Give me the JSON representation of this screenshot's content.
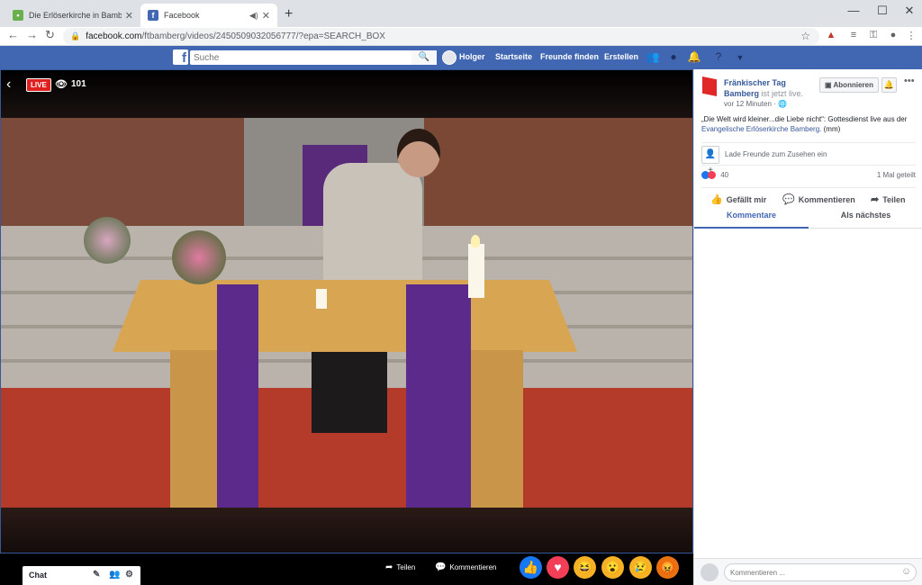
{
  "browser": {
    "tabs": [
      {
        "title": "Die Erlöserkirche in Bamberg ist",
        "active": false
      },
      {
        "title": "Facebook",
        "active": true
      }
    ],
    "new_tab": "+",
    "window_controls": {
      "minimize": "—",
      "maximize": "☐",
      "close": "✕"
    },
    "url_host": "facebook.com",
    "url_path": "/ftbamberg/videos/2450509032056777/?epa=SEARCH_BOX"
  },
  "fb_header": {
    "logo": "f",
    "search_placeholder": "Suche",
    "user_name": "Holger",
    "nav": [
      "Startseite",
      "Freunde finden",
      "Erstellen"
    ]
  },
  "video": {
    "live_label": "LIVE",
    "viewer_count": "101"
  },
  "video_footer": {
    "chat_label": "Chat",
    "share_label": "Teilen",
    "comment_label": "Kommentieren",
    "reactions": [
      "like",
      "love",
      "haha",
      "wow",
      "sad",
      "angry"
    ]
  },
  "panel": {
    "page_name": "Fränkischer Tag Bamberg",
    "live_status": "ist jetzt live.",
    "posted_time": "vor 12 Minuten ·",
    "subscribe_label": "Abonnieren",
    "description_text": "„Die Welt wird kleiner...die Liebe nicht“: Gottesdienst live aus der",
    "description_link": "Evangelische Erlöserkirche Bamberg.",
    "description_suffix": "(mm)",
    "invite_text": "Lade Freunde zum Zusehen ein",
    "reaction_count": "40",
    "share_count": "1 Mal geteilt",
    "actions": {
      "like": "Gefällt mir",
      "comment": "Kommentieren",
      "share": "Teilen"
    },
    "tabs": {
      "comments": "Kommentare",
      "next": "Als nächstes"
    },
    "comment_placeholder": "Kommentieren ..."
  },
  "colors": {
    "fb_blue": "#4267b2",
    "link_blue": "#365899",
    "live_red": "#e02020"
  }
}
